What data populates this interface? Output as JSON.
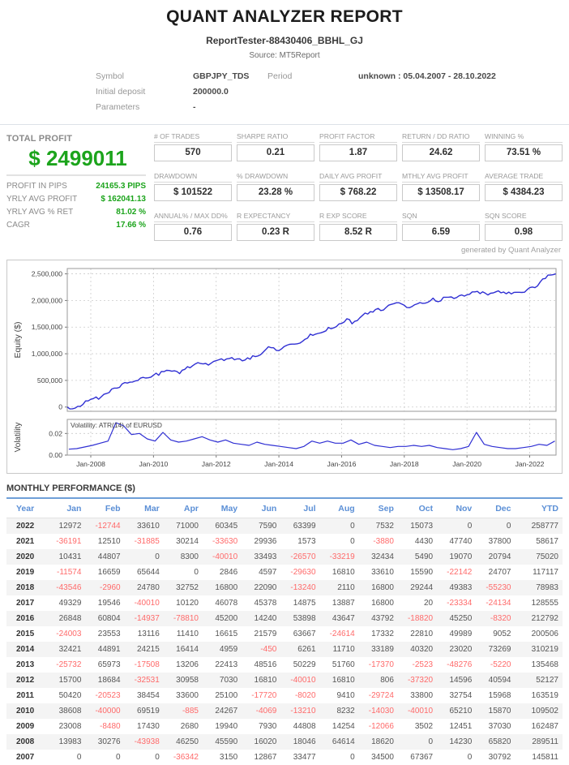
{
  "header": {
    "title": "QUANT ANALYZER REPORT",
    "subtitle": "ReportTester-88430406_BBHL_GJ",
    "source": "Source: MT5Report"
  },
  "info": {
    "symbol_label": "Symbol",
    "symbol": "GBPJPY_TDS",
    "period_label": "Period",
    "period": "unknown : 05.04.2007 - 28.10.2022",
    "initial_deposit_label": "Initial deposit",
    "initial_deposit": "200000.0",
    "parameters_label": "Parameters",
    "parameters": "-"
  },
  "summary": {
    "label": "TOTAL PROFIT",
    "total": "$ 2499011",
    "rows": [
      {
        "label": "PROFIT IN PIPS",
        "value": "24165.3 PIPS"
      },
      {
        "label": "YRLY AVG PROFIT",
        "value": "$ 162041.13"
      },
      {
        "label": "YRLY AVG % RET",
        "value": "81.02 %"
      },
      {
        "label": "CAGR",
        "value": "17.66 %"
      }
    ]
  },
  "stats": [
    {
      "label": "# OF TRADES",
      "value": "570"
    },
    {
      "label": "SHARPE RATIO",
      "value": "0.21"
    },
    {
      "label": "PROFIT FACTOR",
      "value": "1.87"
    },
    {
      "label": "RETURN / DD RATIO",
      "value": "24.62"
    },
    {
      "label": "WINNING %",
      "value": "73.51 %"
    },
    {
      "label": "DRAWDOWN",
      "value": "$ 101522"
    },
    {
      "label": "% DRAWDOWN",
      "value": "23.28 %"
    },
    {
      "label": "DAILY AVG PROFIT",
      "value": "$ 768.22"
    },
    {
      "label": "MTHLY AVG PROFIT",
      "value": "$ 13508.17"
    },
    {
      "label": "AVERAGE TRADE",
      "value": "$ 4384.23"
    },
    {
      "label": "ANNUAL% / MAX DD%",
      "value": "0.76"
    },
    {
      "label": "R EXPECTANCY",
      "value": "0.23 R"
    },
    {
      "label": "R EXP SCORE",
      "value": "8.52 R"
    },
    {
      "label": "SQN",
      "value": "6.59"
    },
    {
      "label": "SQN SCORE",
      "value": "0.98"
    }
  ],
  "generated_by": "generated by Quant Analyzer",
  "colors": {
    "profit_green": "#1ca41c",
    "negative_red": "#ff6a6a",
    "table_header_blue": "#5b8fd6",
    "chart_line_blue": "#2f2fd3"
  },
  "chart_data": {
    "type": "line",
    "equity": {
      "ylabel": "Equity ($)",
      "yticks": [
        0,
        500000,
        1000000,
        1500000,
        2000000,
        2500000
      ],
      "ytick_labels": [
        "0",
        "500,000",
        "1,000,000",
        "1,500,000",
        "2,000,000",
        "2,500,000"
      ],
      "ylim": [
        -80000,
        2600000
      ],
      "series_note": "equity curve = running cumulative sum of monthly.rows values, Apr-2007 (start 0) through Oct-2022 (end 2499011)",
      "line_color": "#2f2fd3"
    },
    "volatility": {
      "ylabel": "Volatility",
      "annotation": "Volatility: ATR(14) of EURUSD",
      "yticks": [
        0,
        0.02
      ],
      "ytick_labels": [
        "0.00",
        "0.02"
      ],
      "ylim": [
        0,
        0.033
      ],
      "x_range": [
        2007.3,
        2022.8
      ],
      "values": [
        0.0055,
        0.006,
        0.0075,
        0.009,
        0.011,
        0.013,
        0.03,
        0.027,
        0.019,
        0.02,
        0.015,
        0.013,
        0.021,
        0.014,
        0.012,
        0.013,
        0.015,
        0.017,
        0.014,
        0.012,
        0.014,
        0.011,
        0.01,
        0.009,
        0.012,
        0.01,
        0.009,
        0.008,
        0.007,
        0.006,
        0.008,
        0.013,
        0.011,
        0.013,
        0.011,
        0.011,
        0.014,
        0.01,
        0.012,
        0.009,
        0.008,
        0.007,
        0.008,
        0.008,
        0.009,
        0.008,
        0.009,
        0.007,
        0.006,
        0.005,
        0.006,
        0.008,
        0.021,
        0.01,
        0.008,
        0.007,
        0.006,
        0.006,
        0.007,
        0.008,
        0.01,
        0.009,
        0.013
      ]
    },
    "x": {
      "range": [
        2007.25,
        2022.84
      ],
      "ticks": [
        2008,
        2010,
        2012,
        2014,
        2016,
        2018,
        2020,
        2022
      ],
      "tick_labels": [
        "Jan-2008",
        "Jan-2010",
        "Jan-2012",
        "Jan-2014",
        "Jan-2016",
        "Jan-2018",
        "Jan-2020",
        "Jan-2022"
      ]
    },
    "grid": "dashed",
    "legend": "none"
  },
  "monthly": {
    "title": "MONTHLY PERFORMANCE ($)",
    "columns": [
      "Year",
      "Jan",
      "Feb",
      "Mar",
      "Apr",
      "May",
      "Jun",
      "Jul",
      "Aug",
      "Sep",
      "Oct",
      "Nov",
      "Dec",
      "YTD"
    ],
    "rows": [
      {
        "year": "2022",
        "values": [
          12972,
          -12744,
          33610,
          71000,
          60345,
          7590,
          63399,
          0,
          7532,
          15073,
          0,
          0
        ],
        "ytd": 258777
      },
      {
        "year": "2021",
        "values": [
          -36191,
          12510,
          -31885,
          30214,
          -33630,
          29936,
          1573,
          0,
          -3880,
          4430,
          47740,
          37800
        ],
        "ytd": 58617
      },
      {
        "year": "2020",
        "values": [
          10431,
          44807,
          0,
          8300,
          -40010,
          33493,
          -26570,
          -33219,
          32434,
          5490,
          19070,
          20794
        ],
        "ytd": 75020
      },
      {
        "year": "2019",
        "values": [
          -11574,
          16659,
          65644,
          0,
          2846,
          4597,
          -29630,
          16810,
          33610,
          15590,
          -22142,
          24707
        ],
        "ytd": 117117
      },
      {
        "year": "2018",
        "values": [
          -43546,
          -2960,
          24780,
          32752,
          16800,
          22090,
          -13240,
          2110,
          16800,
          29244,
          49383,
          -55230
        ],
        "ytd": 78983
      },
      {
        "year": "2017",
        "values": [
          49329,
          19546,
          -40010,
          10120,
          46078,
          45378,
          14875,
          13887,
          16800,
          20,
          -23334,
          -24134
        ],
        "ytd": 128555
      },
      {
        "year": "2016",
        "values": [
          26848,
          60804,
          -14937,
          -78810,
          45200,
          14240,
          53898,
          43647,
          43792,
          -18820,
          45250,
          -8320
        ],
        "ytd": 212792
      },
      {
        "year": "2015",
        "values": [
          -24003,
          23553,
          13116,
          11410,
          16615,
          21579,
          63667,
          -24614,
          17332,
          22810,
          49989,
          9052
        ],
        "ytd": 200506
      },
      {
        "year": "2014",
        "values": [
          32421,
          44891,
          24215,
          16414,
          4959,
          -450,
          6261,
          11710,
          33189,
          40320,
          23020,
          73269
        ],
        "ytd": 310219
      },
      {
        "year": "2013",
        "values": [
          -25732,
          65973,
          -17508,
          13206,
          22413,
          48516,
          50229,
          51760,
          -17370,
          -2523,
          -48276,
          -5220
        ],
        "ytd": 135468
      },
      {
        "year": "2012",
        "values": [
          15700,
          18684,
          -32531,
          30958,
          7030,
          16810,
          -40010,
          16810,
          806,
          -37320,
          14596,
          40594
        ],
        "ytd": 52127
      },
      {
        "year": "2011",
        "values": [
          50420,
          -20523,
          38454,
          33600,
          25100,
          -17720,
          -8020,
          9410,
          -29724,
          33800,
          32754,
          15968
        ],
        "ytd": 163519
      },
      {
        "year": "2010",
        "values": [
          38608,
          -40000,
          69519,
          -885,
          24267,
          -4069,
          -13210,
          8232,
          -14030,
          -40010,
          65210,
          15870
        ],
        "ytd": 109502
      },
      {
        "year": "2009",
        "values": [
          23008,
          -8480,
          17430,
          2680,
          19940,
          7930,
          44808,
          14254,
          -12066,
          3502,
          12451,
          37030
        ],
        "ytd": 162487
      },
      {
        "year": "2008",
        "values": [
          13983,
          30276,
          -43938,
          46250,
          45590,
          16020,
          18046,
          64614,
          18620,
          0,
          14230,
          65820
        ],
        "ytd": 289511
      },
      {
        "year": "2007",
        "values": [
          0,
          0,
          0,
          -36342,
          3150,
          12867,
          33477,
          0,
          34500,
          67367,
          0,
          30792
        ],
        "ytd": 145811
      }
    ]
  }
}
